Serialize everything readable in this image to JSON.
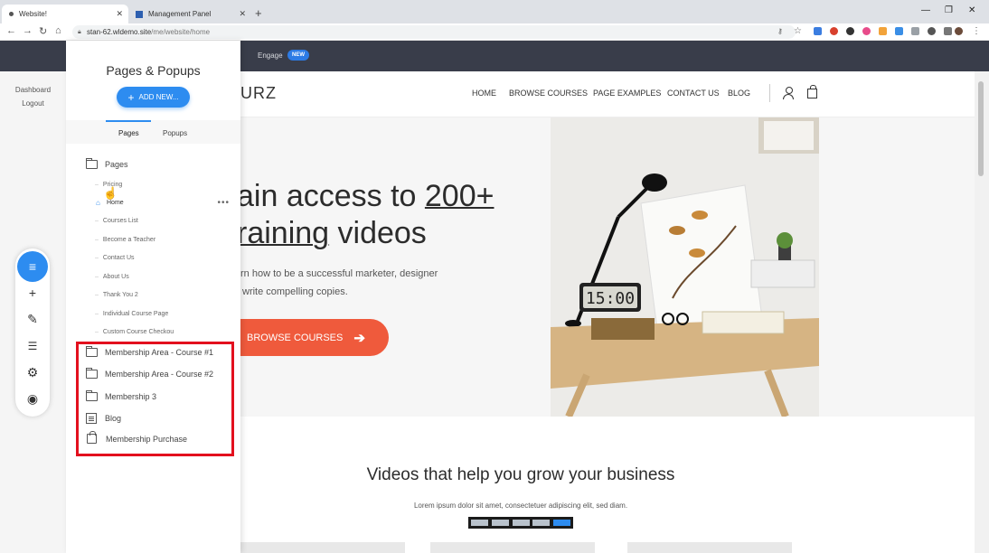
{
  "browser": {
    "tabs": [
      {
        "label": "Website!",
        "active": true
      },
      {
        "label": "Management Panel",
        "active": false
      }
    ],
    "new_tab": "+",
    "url_host": "stan-62.wldemo.site",
    "url_path": "/me/website/home"
  },
  "app_header": {
    "engage_label": "Engage",
    "new_badge": "NEW"
  },
  "left_links": {
    "dashboard": "Dashboard",
    "logout": "Logout"
  },
  "panel": {
    "title": "Pages & Popups",
    "add_new_label": "ADD NEW...",
    "tabs": [
      "Pages",
      "Popups"
    ],
    "root_folder": "Pages",
    "home_item": "Home",
    "items": [
      "Pricing",
      "Courses List",
      "Become a Teacher",
      "Contact Us",
      "About Us",
      "Thank You 2",
      "Individual Course Page",
      "Custom Course Checkou"
    ],
    "folders": [
      "Membership Area - Course #1",
      "Membership Area - Course #2",
      "Membership 3"
    ],
    "blog_item": "Blog",
    "purchase_item": "Membership Purchase"
  },
  "site": {
    "logo": "URZ",
    "nav": [
      "HOME",
      "BROWSE COURSES",
      "PAGE EXAMPLES",
      "CONTACT US",
      "BLOG"
    ],
    "hero_line1_pre": "ain access to ",
    "hero_line1_link": "200+",
    "hero_line2_link": "raining",
    "hero_line2_post": " videos",
    "hero_sub1": "rn how to be a successful marketer, designer",
    "hero_sub2": "write compelling copies.",
    "hero_button": "BROWSE COURSES",
    "clock_text": "15:00",
    "section_title": "Videos that help you grow your business",
    "section_sub": "Lorem ipsum dolor sit amet, consectetuer adipiscing elit, sed diam."
  },
  "colors": {
    "accent": "#2d8cf0",
    "cta": "#ef5a3c",
    "highlight_box": "#e3101e",
    "header_dark": "#393d4a"
  }
}
